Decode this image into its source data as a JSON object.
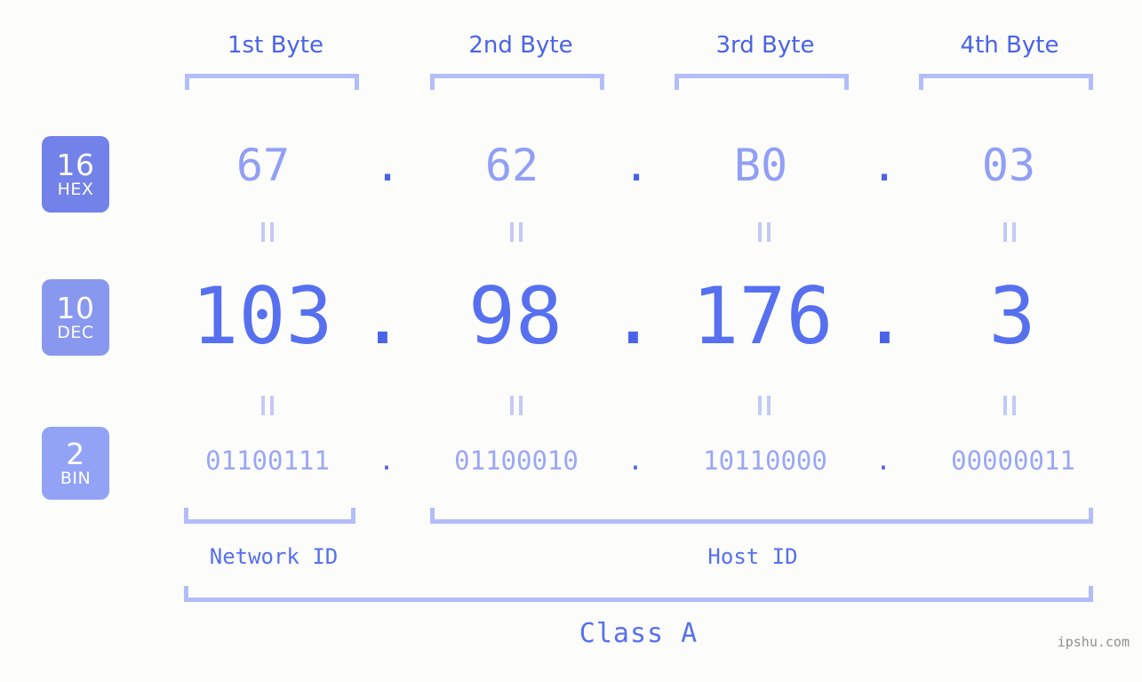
{
  "page": {
    "background_color": "#fcfdfa",
    "watermark": "ipshu.com"
  },
  "colors": {
    "header_text": "#4a63e8",
    "bracket": "#b3bdf9",
    "hex_value": "#919ff5",
    "dec_value": "#5670ef",
    "bin_value": "#9aa7f7",
    "dot": "#4a63e8",
    "equals_mark": "#c3caf7",
    "badge_hex_bg": "#7382e8",
    "badge_dec_bg": "#8998ef",
    "badge_bin_bg": "#92a3f5",
    "badge_text": "#ffffff",
    "watermark_text": "#8f8f8f"
  },
  "byte_headers": [
    {
      "label": "1st Byte"
    },
    {
      "label": "2nd Byte"
    },
    {
      "label": "3rd Byte"
    },
    {
      "label": "4th Byte"
    }
  ],
  "bases": [
    {
      "number": "16",
      "abbr": "HEX"
    },
    {
      "number": "10",
      "abbr": "DEC"
    },
    {
      "number": "2",
      "abbr": "BIN"
    }
  ],
  "separator": ".",
  "rows": {
    "hex": {
      "base_number": "16",
      "base_abbr": "HEX",
      "values": [
        "67",
        "62",
        "B0",
        "03"
      ]
    },
    "dec": {
      "base_number": "10",
      "base_abbr": "DEC",
      "values": [
        "103",
        "98",
        "176",
        "3"
      ]
    },
    "bin": {
      "base_number": "2",
      "base_abbr": "BIN",
      "values": [
        "01100111",
        "01100010",
        "10110000",
        "00000011"
      ]
    }
  },
  "ip_address": {
    "hex": "67.62.B0.03",
    "dec": "103.98.176.3",
    "bin": "01100111.01100010.10110000.00000011"
  },
  "segments": {
    "network_id": "Network ID",
    "host_id": "Host ID",
    "class": "Class A"
  }
}
